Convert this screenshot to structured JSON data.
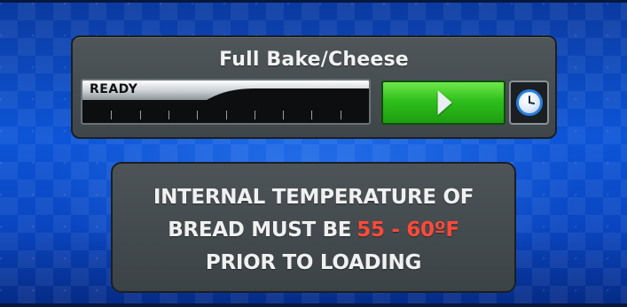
{
  "program": {
    "title": "Full Bake/Cheese",
    "status": "READY",
    "progress_ticks": 10,
    "start_icon": "play-icon",
    "timer_icon": "clock-icon"
  },
  "notice": {
    "line1": "INTERNAL TEMPERATURE OF",
    "line2_prefix": "BREAD MUST BE",
    "temperature_range": "55 - 60ºF",
    "line3": "PRIOR TO LOADING"
  },
  "colors": {
    "background": "#0d55d8",
    "panel": "#464d51",
    "start_button": "#2fbf1c",
    "temperature_highlight": "#ff4a3a"
  }
}
